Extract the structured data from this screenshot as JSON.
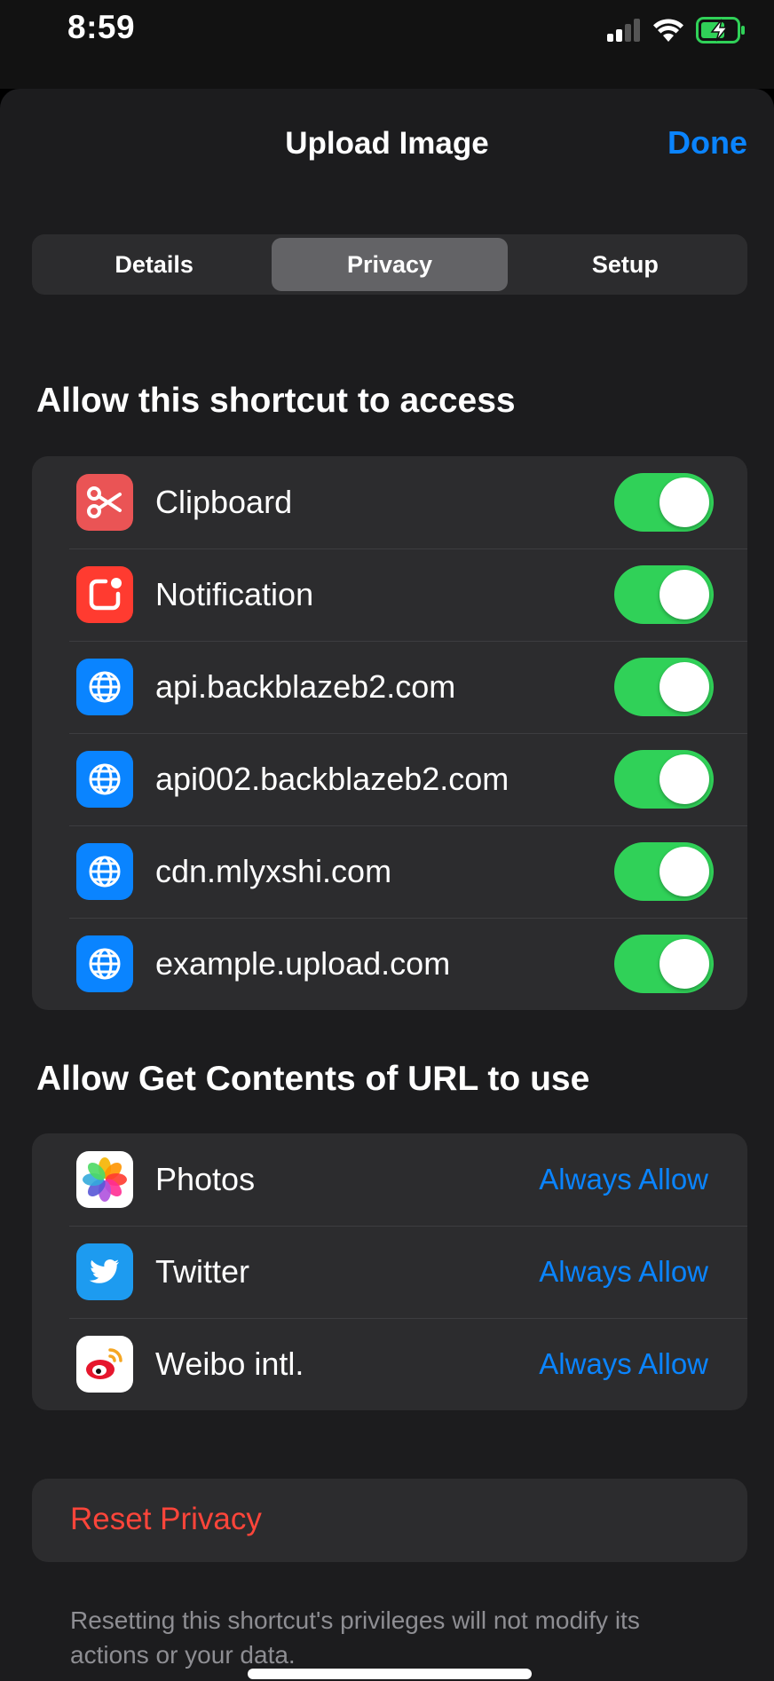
{
  "status_bar": {
    "time": "8:59"
  },
  "nav": {
    "title": "Upload Image",
    "done_label": "Done"
  },
  "segments": [
    "Details",
    "Privacy",
    "Setup"
  ],
  "selected_segment": "Privacy",
  "access_section": {
    "header": "Allow this shortcut to access",
    "items": [
      {
        "label": "Clipboard",
        "icon": "scissors-icon",
        "enabled": true
      },
      {
        "label": "Notification",
        "icon": "notification-icon",
        "enabled": true
      },
      {
        "label": "api.backblazeb2.com",
        "icon": "globe-icon",
        "enabled": true
      },
      {
        "label": "api002.backblazeb2.com",
        "icon": "globe-icon",
        "enabled": true
      },
      {
        "label": "cdn.mlyxshi.com",
        "icon": "globe-icon",
        "enabled": true
      },
      {
        "label": "example.upload.com",
        "icon": "globe-icon",
        "enabled": true
      }
    ]
  },
  "url_section": {
    "header": "Allow Get Contents of URL to use",
    "items": [
      {
        "label": "Photos",
        "icon": "photos-icon",
        "value": "Always Allow"
      },
      {
        "label": "Twitter",
        "icon": "twitter-bird-icon",
        "value": "Always Allow"
      },
      {
        "label": "Weibo intl.",
        "icon": "weibo-icon",
        "value": "Always Allow"
      }
    ]
  },
  "reset": {
    "label": "Reset Privacy",
    "footnote": "Resetting this shortcut's privileges will not modify its actions or your data."
  },
  "colors": {
    "accent": "#0a84ff",
    "toggle_on": "#30d158",
    "destructive": "#ff453a",
    "clipboard_icon_bg": "#ea5455",
    "notification_icon_bg": "#ff3b30",
    "globe_icon_bg": "#0a84ff",
    "twitter_icon_bg": "#1d9bf0"
  }
}
